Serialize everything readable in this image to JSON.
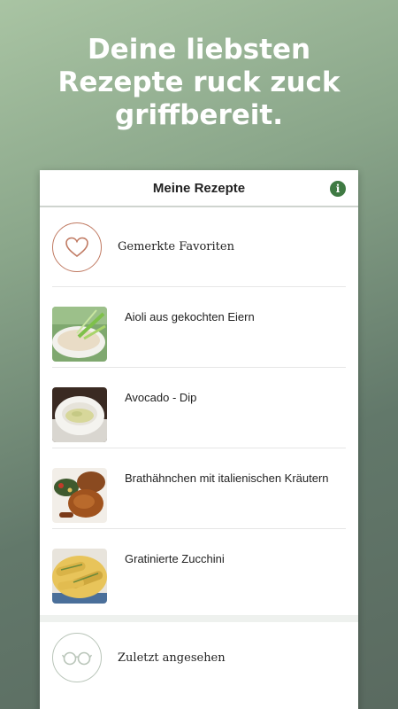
{
  "headline": {
    "line1": "Deine liebsten",
    "line2": "Rezepte ruck zuck",
    "line3": "griffbereit."
  },
  "header": {
    "title": "Meine Rezepte",
    "info_icon": "info-icon",
    "info_glyph": "i"
  },
  "favorites": {
    "label": "Gemerkte Favoriten",
    "icon": "heart-icon"
  },
  "recipes": [
    {
      "title": "Aioli aus gekochten Eiern"
    },
    {
      "title": "Avocado - Dip"
    },
    {
      "title": "Brathähnchen mit italienischen Kräutern"
    },
    {
      "title": "Gratinierte Zucchini"
    }
  ],
  "recent": {
    "label": "Zuletzt angesehen",
    "icon": "glasses-icon"
  },
  "colors": {
    "accent": "#3f7a43",
    "heart": "#c07a62"
  }
}
